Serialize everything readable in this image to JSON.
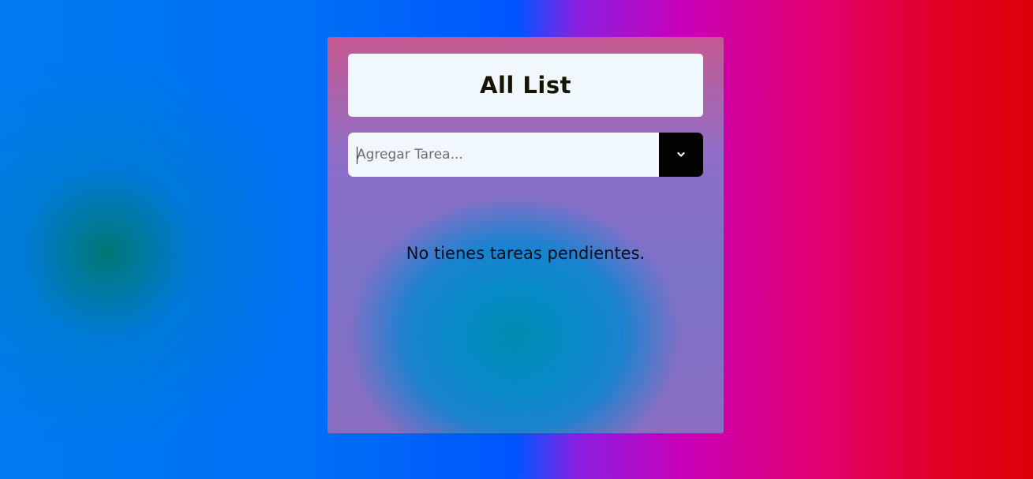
{
  "app": {
    "title": "All List"
  },
  "task_input": {
    "placeholder": "Agregar Tarea...",
    "value": ""
  },
  "add_button": {
    "icon": "chevron-down-icon"
  },
  "empty_state": {
    "message": "No tienes tareas pendientes."
  },
  "colors": {
    "card_header_bg": "#f0f7fd",
    "button_bg": "#020202",
    "title_color": "#141400"
  }
}
